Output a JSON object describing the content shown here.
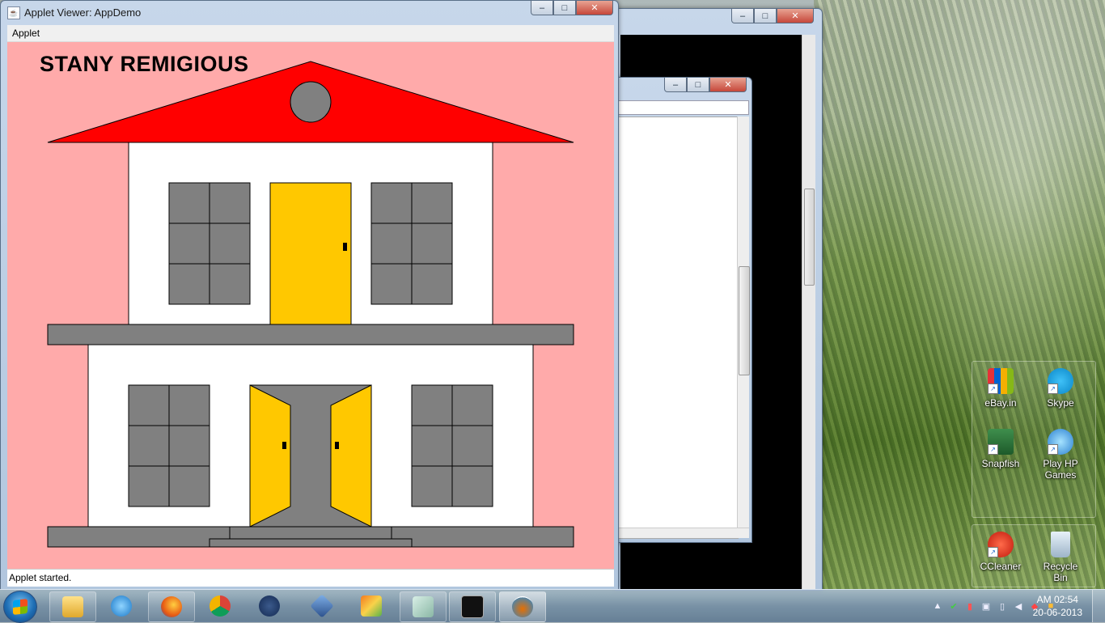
{
  "desktop": {
    "icons": [
      {
        "label": "eBay.in",
        "icon": "ebay-icon"
      },
      {
        "label": "Skype",
        "icon": "skype-icon"
      },
      {
        "label": "Snapfish",
        "icon": "snapfish-icon"
      },
      {
        "label": "Play HP Games",
        "icon": "hp-games-icon"
      },
      {
        "label": "CCleaner",
        "icon": "ccleaner-icon"
      },
      {
        "label": "Recycle Bin",
        "icon": "recycle-bin-icon"
      }
    ]
  },
  "applet_window": {
    "title": "Applet Viewer: AppDemo",
    "menu": [
      "Applet"
    ],
    "status": "Applet started.",
    "caption_buttons": {
      "minimize": "–",
      "maximize": "□",
      "close": "✕"
    }
  },
  "drawing": {
    "heading": "STANY REMIGIOUS",
    "colors": {
      "background": "#ffaaaa",
      "roof": "#ff0000",
      "wall": "#ffffff",
      "window": "#808080",
      "door": "#ffc800",
      "floor": "#808080",
      "outline": "#000000"
    }
  },
  "taskbar": {
    "apps": [
      {
        "icon": "windows-explorer-icon"
      },
      {
        "icon": "internet-explorer-icon"
      },
      {
        "icon": "firefox-icon"
      },
      {
        "icon": "chrome-icon"
      },
      {
        "icon": "hp-icon"
      },
      {
        "icon": "network-tool-icon"
      },
      {
        "icon": "photo-gallery-icon"
      },
      {
        "icon": "notes-icon"
      },
      {
        "icon": "command-prompt-icon"
      },
      {
        "icon": "java-icon"
      }
    ],
    "clock": {
      "time": "AM 02:54",
      "date": "20-06-2013"
    }
  }
}
